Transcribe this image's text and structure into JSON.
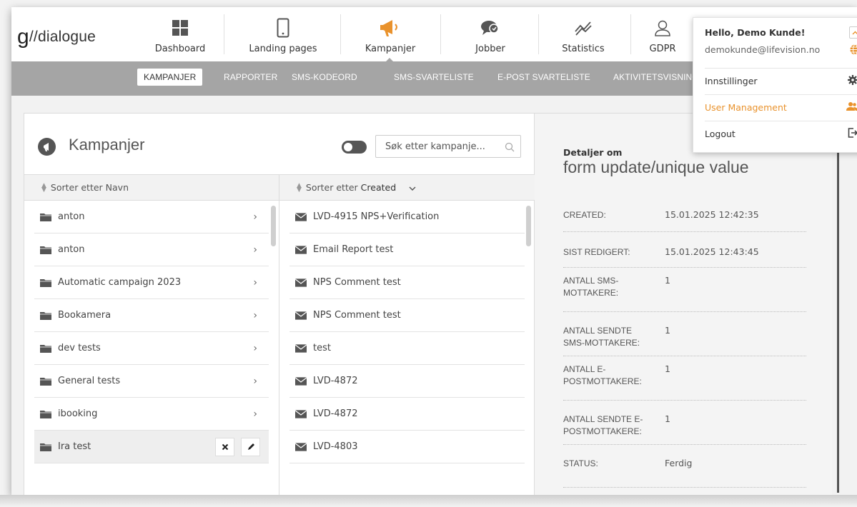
{
  "brand": {
    "logo_g": "g",
    "logo_text": "//dialogue"
  },
  "nav": {
    "items": [
      {
        "label": "Dashboard",
        "icon": "dashboard-icon"
      },
      {
        "label": "Landing pages",
        "icon": "mobile-icon"
      },
      {
        "label": "Kampanjer",
        "icon": "megaphone-icon",
        "active": true
      },
      {
        "label": "Jobber",
        "icon": "chat-icon"
      },
      {
        "label": "Statistics",
        "icon": "trend-icon"
      },
      {
        "label": "GDPR",
        "icon": "user-icon"
      }
    ]
  },
  "subnav": {
    "items": [
      "KAMPANJER",
      "RAPPORTER",
      "SMS-KODEORD",
      "SMS-SVARTELISTE",
      "E-POST SVARTELISTE",
      "AKTIVITETSVISNING"
    ],
    "active": "KAMPANJER"
  },
  "campaigns": {
    "title": "Kampanjer",
    "search_placeholder": "Søk etter kampanje...",
    "folders_sort": {
      "prefix": "Sorter etter",
      "field": "Navn"
    },
    "campaigns_sort": {
      "prefix": "Sorter etter",
      "field": "Created"
    },
    "folders": [
      {
        "name": "anton"
      },
      {
        "name": "anton"
      },
      {
        "name": "Automatic campaign 2023"
      },
      {
        "name": "Bookamera"
      },
      {
        "name": "dev tests"
      },
      {
        "name": "General tests"
      },
      {
        "name": "ibooking"
      },
      {
        "name": "Ira test",
        "selected": true
      }
    ],
    "list": [
      "LVD-4915 NPS+Verification",
      "Email Report test",
      "NPS Comment test",
      "NPS Comment test",
      "test",
      "LVD-4872",
      "LVD-4872",
      "LVD-4803"
    ]
  },
  "details": {
    "label": "Detaljer om",
    "title": "form update/unique value",
    "rows": [
      {
        "key": "CREATED:",
        "value": "15.01.2025 12:42:35"
      },
      {
        "key": "SIST REDIGERT:",
        "value": "15.01.2025 12:43:45"
      },
      {
        "key": "ANTALL SMS-MOTTAKERE:",
        "value": "1"
      },
      {
        "key": "ANTALL SENDTE SMS-MOTTAKERE:",
        "value": "1"
      },
      {
        "key": "ANTALL E-POSTMOTTAKERE:",
        "value": "1"
      },
      {
        "key": "ANTALL SENDTE E-POSTMOTTAKERE:",
        "value": "1"
      },
      {
        "key": "STATUS:",
        "value": "Ferdig"
      }
    ]
  },
  "user_menu": {
    "greeting": "Hello, Demo Kunde!",
    "email": "demokunde@lifevision.no",
    "items": [
      {
        "label": "Innstillinger",
        "icon": "gear-icon"
      },
      {
        "label": "User Management",
        "icon": "users-icon"
      },
      {
        "label": "Logout",
        "icon": "logout-icon"
      }
    ]
  },
  "colors": {
    "accent": "#e9922c",
    "subnav_bg": "#a5a5a5",
    "icon_dark": "#555555"
  }
}
